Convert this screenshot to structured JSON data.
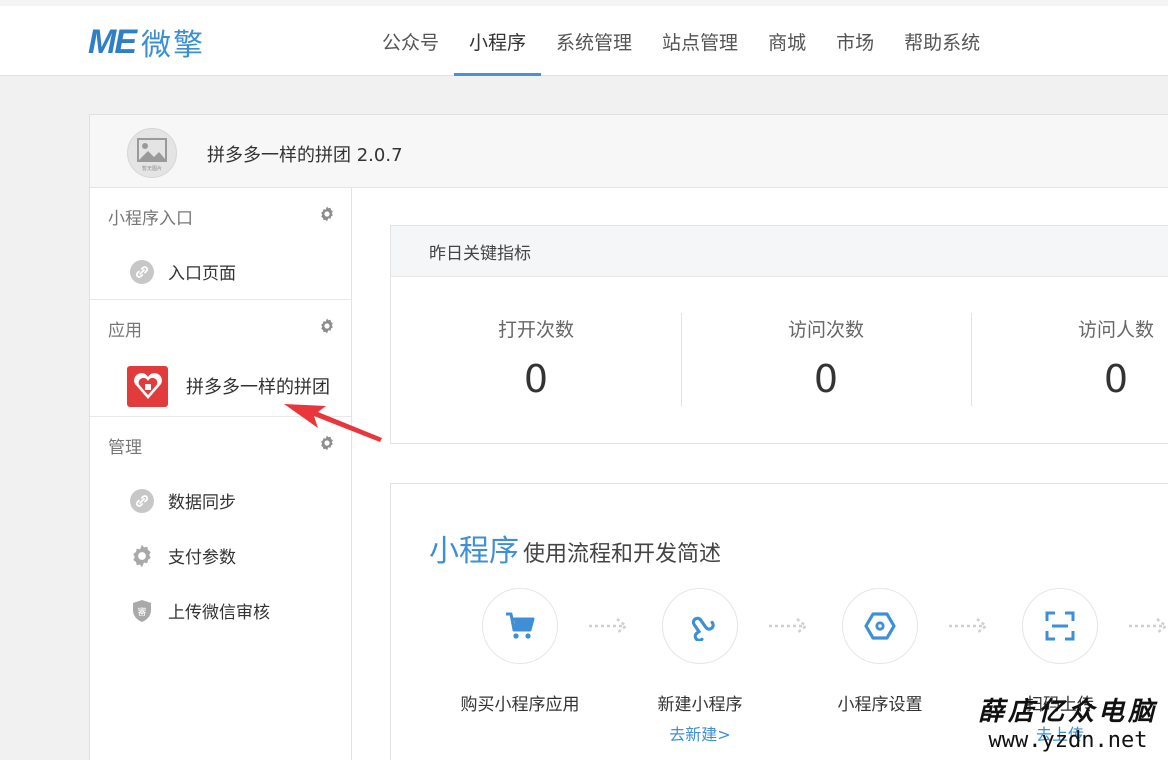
{
  "header": {
    "logo_mark": "ME",
    "logo_text": "微擎",
    "nav": [
      "公众号",
      "小程序",
      "系统管理",
      "站点管理",
      "商城",
      "市场",
      "帮助系统"
    ],
    "active_nav": "小程序"
  },
  "app": {
    "avatar_caption": "暂无图片",
    "title": "拼多多一样的拼团 2.0.7"
  },
  "sidebar": {
    "sections": [
      {
        "title": "小程序入口",
        "items": [
          {
            "label": "入口页面",
            "icon": "link-icon"
          }
        ]
      },
      {
        "title": "应用",
        "items": [
          {
            "label": "拼多多一样的拼团",
            "icon": "pinduoduo-logo"
          }
        ]
      },
      {
        "title": "管理",
        "items": [
          {
            "label": "数据同步",
            "icon": "link-icon"
          },
          {
            "label": "支付参数",
            "icon": "gear-icon"
          },
          {
            "label": "上传微信审核",
            "icon": "shield-icon"
          }
        ]
      }
    ]
  },
  "metrics": {
    "title": "昨日关键指标",
    "items": [
      {
        "label": "打开次数",
        "value": "0"
      },
      {
        "label": "访问次数",
        "value": "0"
      },
      {
        "label": "访问人数",
        "value": "0"
      }
    ]
  },
  "flow": {
    "title_highlight": "小程序",
    "title_rest": "使用流程和开发简述",
    "steps": [
      {
        "label": "购买小程序应用",
        "link": "",
        "icon": "cart-icon"
      },
      {
        "label": "新建小程序",
        "link": "去新建>",
        "icon": "link-icon"
      },
      {
        "label": "小程序设置",
        "link": "",
        "icon": "hexagon-icon"
      },
      {
        "label": "扫码上传",
        "link": "去上传",
        "icon": "scan-icon"
      }
    ]
  },
  "watermark": {
    "line1": "薛店亿众电脑",
    "line2": "www.yzdn.net"
  },
  "colors": {
    "accent": "#3f8fd6",
    "app_logo": "#e23b3b",
    "annotation_arrow": "#e8363a"
  }
}
